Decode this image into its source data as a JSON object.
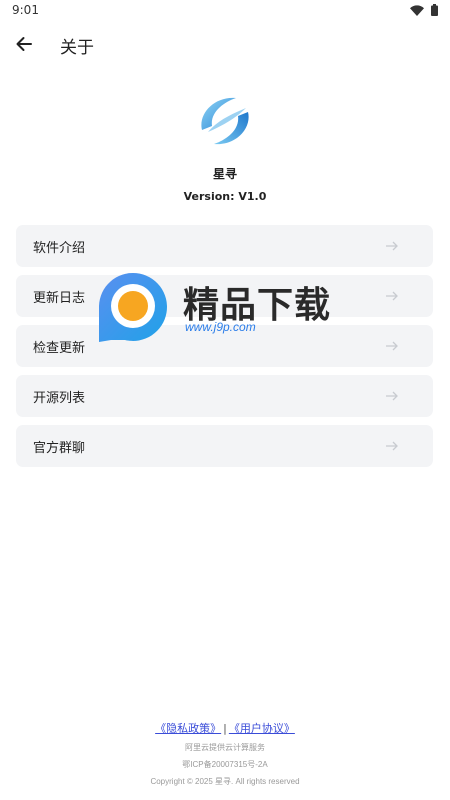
{
  "status_bar": {
    "time": "9:01"
  },
  "app_bar": {
    "title": "关于"
  },
  "about": {
    "app_name": "星寻",
    "version": "Version: V1.0"
  },
  "menu": {
    "items": [
      {
        "label": "软件介绍"
      },
      {
        "label": "更新日志"
      },
      {
        "label": "检查更新"
      },
      {
        "label": "开源列表"
      },
      {
        "label": "官方群聊"
      }
    ]
  },
  "watermark": {
    "title": "精品下载",
    "url": "www.j9p.com"
  },
  "footer": {
    "privacy_policy": "《隐私政策》",
    "separator": "|",
    "user_agreement": "《用户协议》",
    "hosting": "阿里云提供云计算服务",
    "icp": "鄂ICP备20007315号-2A",
    "copyright": "Copyright © 2025 星寻. All rights reserved"
  },
  "colors": {
    "accent": "#3a4cd8",
    "card_bg": "#f3f4f6",
    "logo_blue": "#3aa0e0"
  }
}
